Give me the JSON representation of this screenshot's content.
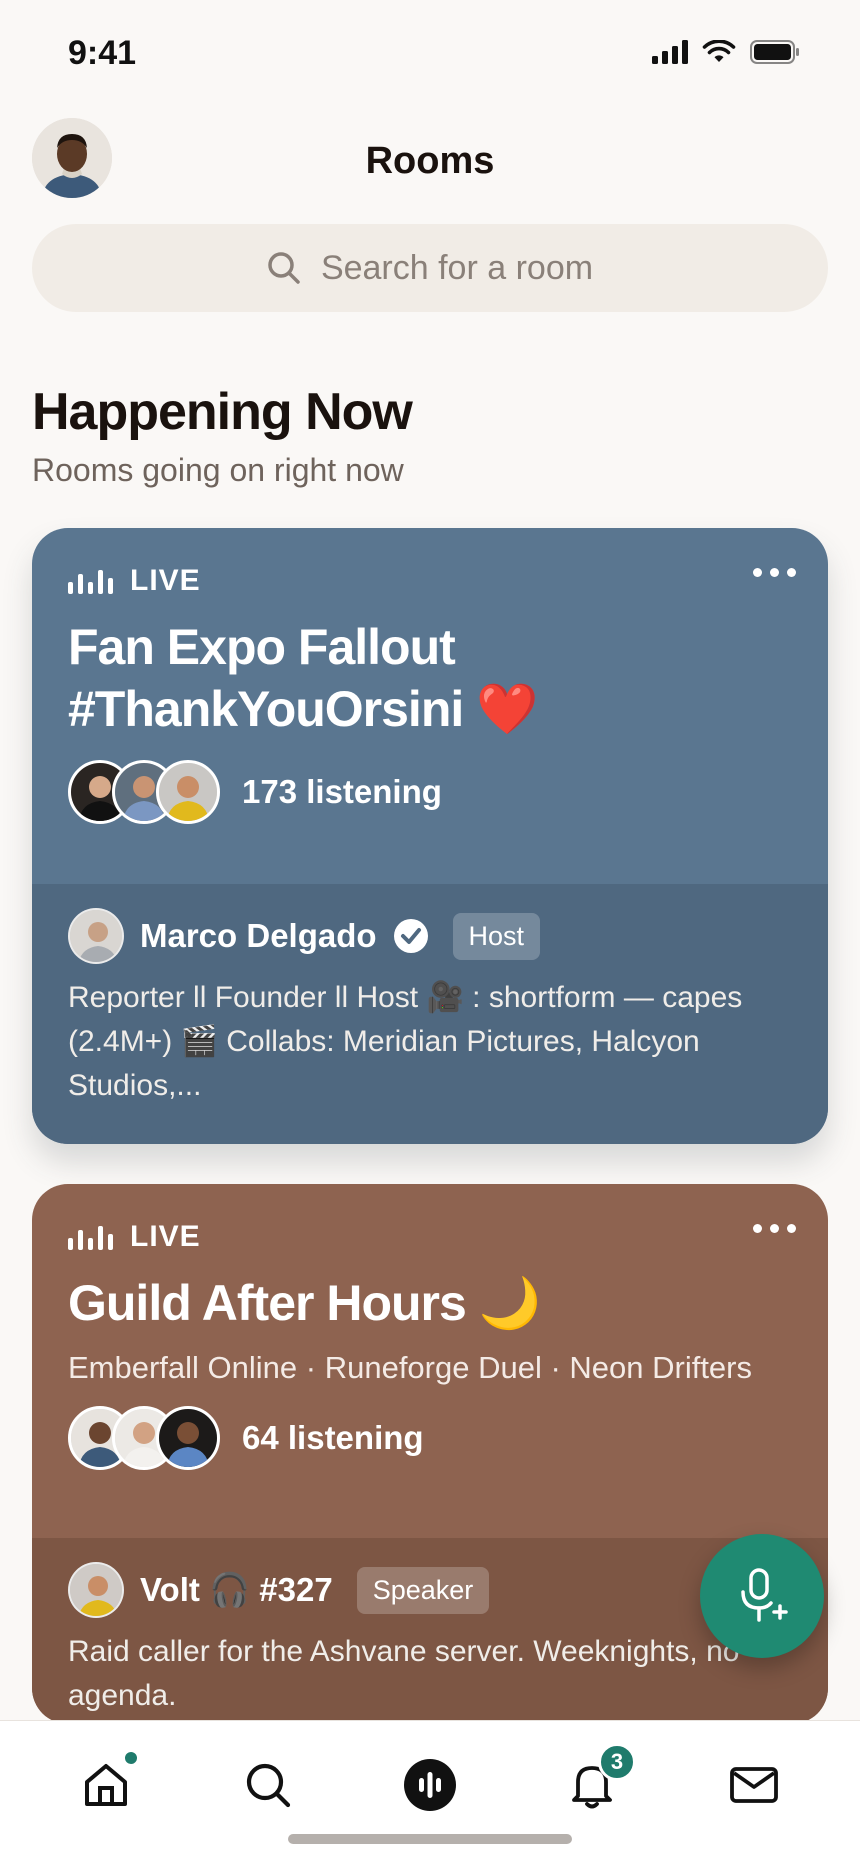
{
  "status_bar": {
    "time": "9:41"
  },
  "header": {
    "title": "Rooms",
    "avatar_icon": "user-avatar"
  },
  "search": {
    "placeholder": "Search for a room"
  },
  "section": {
    "title": "Happening Now",
    "subtitle": "Rooms going on right now"
  },
  "rooms": [
    {
      "live_label": "LIVE",
      "title_line1": "Fan Expo Fallout",
      "title_line2": "#ThankYouOrsini ❤️",
      "listening": "173 listening",
      "host_name": "Marco Delgado",
      "role": "Host",
      "bio": "Reporter ll Founder ll Host 🎥 : shortform — capes (2.4M+) 🎬  Collabs: Meridian Pictures, Halcyon Studios,...",
      "color": "#5a7690"
    },
    {
      "live_label": "LIVE",
      "title_line1": "Guild After Hours 🌙",
      "tags": "Emberfall Online · Runeforge Duel · Neon Drifters",
      "listening": "64 listening",
      "host_name": "Volt 🎧 #327",
      "role": "Speaker",
      "bio": "Raid caller for the Ashvane server. Weeknights, no agenda.",
      "color": "#8e6350"
    }
  ],
  "tab_bar": {
    "items": [
      "home-icon",
      "search-icon",
      "rooms-icon",
      "bell-icon",
      "mail-icon"
    ],
    "notification_count": "3"
  },
  "colors": {
    "accent": "#1f8a72",
    "background": "#faf8f6"
  }
}
